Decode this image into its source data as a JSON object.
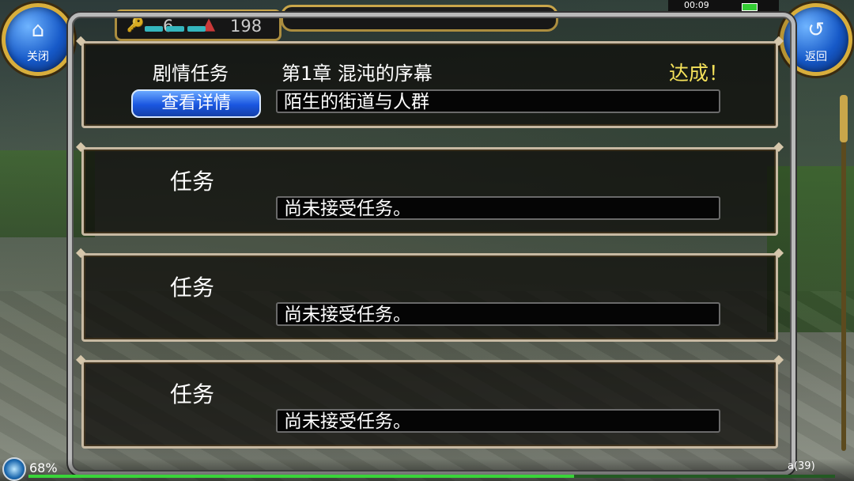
{
  "hud": {
    "key_count": "6",
    "warning_count": "198",
    "clock": "00:09",
    "battery_percent": "68%",
    "level_text": "a(39)"
  },
  "buttons": {
    "close_label": "关闭",
    "back_label": "返回"
  },
  "story_quest": {
    "type_label": "剧情任务",
    "chapter": "第1章 混沌的序幕",
    "status": "达成！",
    "details_button": "查看详情",
    "quest_name": "陌生的街道与人群"
  },
  "quests": [
    {
      "type_label": "任务",
      "status_text": "尚未接受任务。"
    },
    {
      "type_label": "任务",
      "status_text": "尚未接受任务。"
    },
    {
      "type_label": "任务",
      "status_text": "尚未接受任务。"
    }
  ],
  "colors": {
    "accent_gold": "#c9a64a",
    "done_yellow": "#f4e15a",
    "button_blue": "#1a56e0"
  },
  "icons": {
    "home": "home-icon",
    "return": "return-arrow-icon",
    "key": "key-icon",
    "warning": "warning-triangle-icon"
  }
}
